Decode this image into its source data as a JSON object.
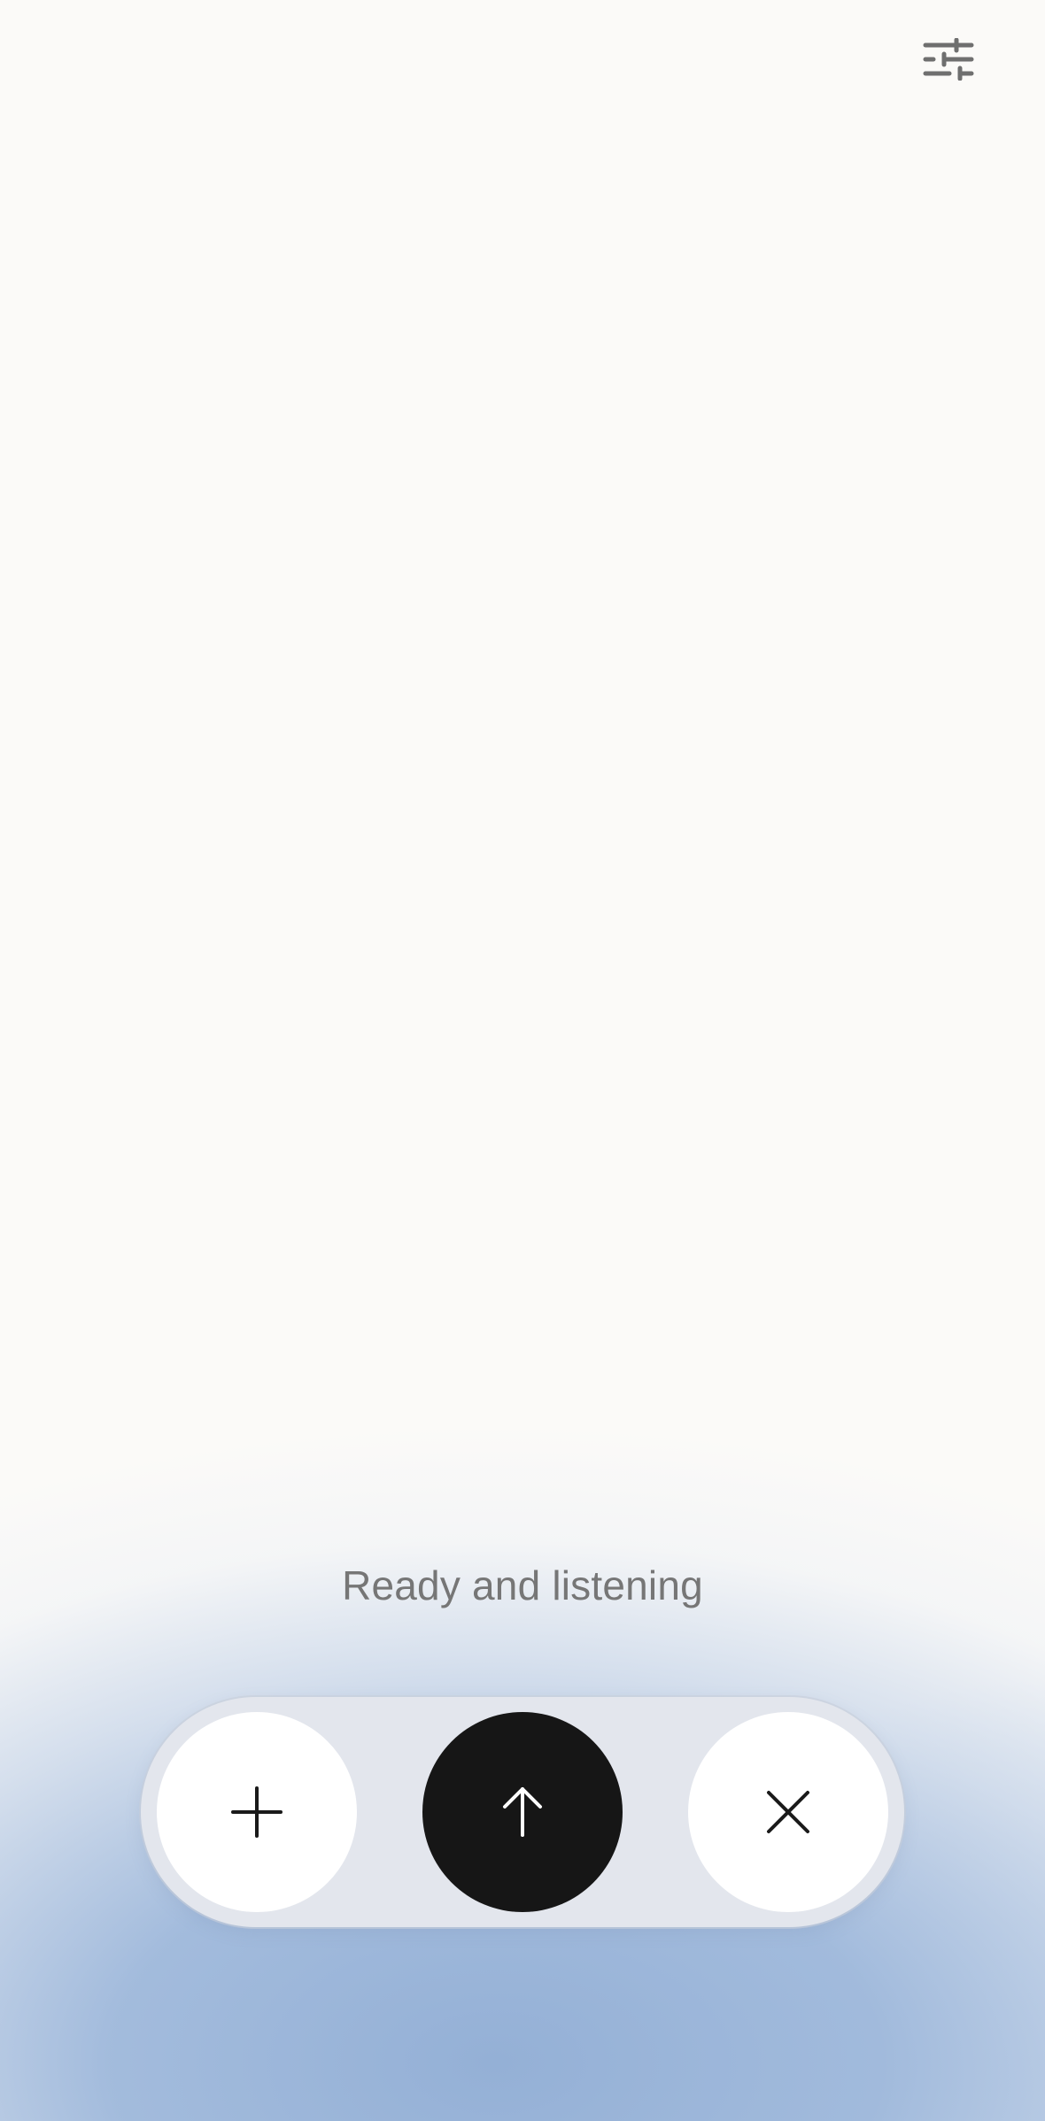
{
  "header": {
    "settings_icon": "sliders-icon"
  },
  "status": {
    "text": "Ready and listening"
  },
  "controls": {
    "add_icon": "plus-icon",
    "send_icon": "arrow-up-icon",
    "close_icon": "close-icon"
  },
  "colors": {
    "background": "#fbfaf8",
    "glow": "#9fb8da",
    "pill": "#e3e6ed",
    "send_button": "#161616",
    "status_text": "#767676"
  }
}
